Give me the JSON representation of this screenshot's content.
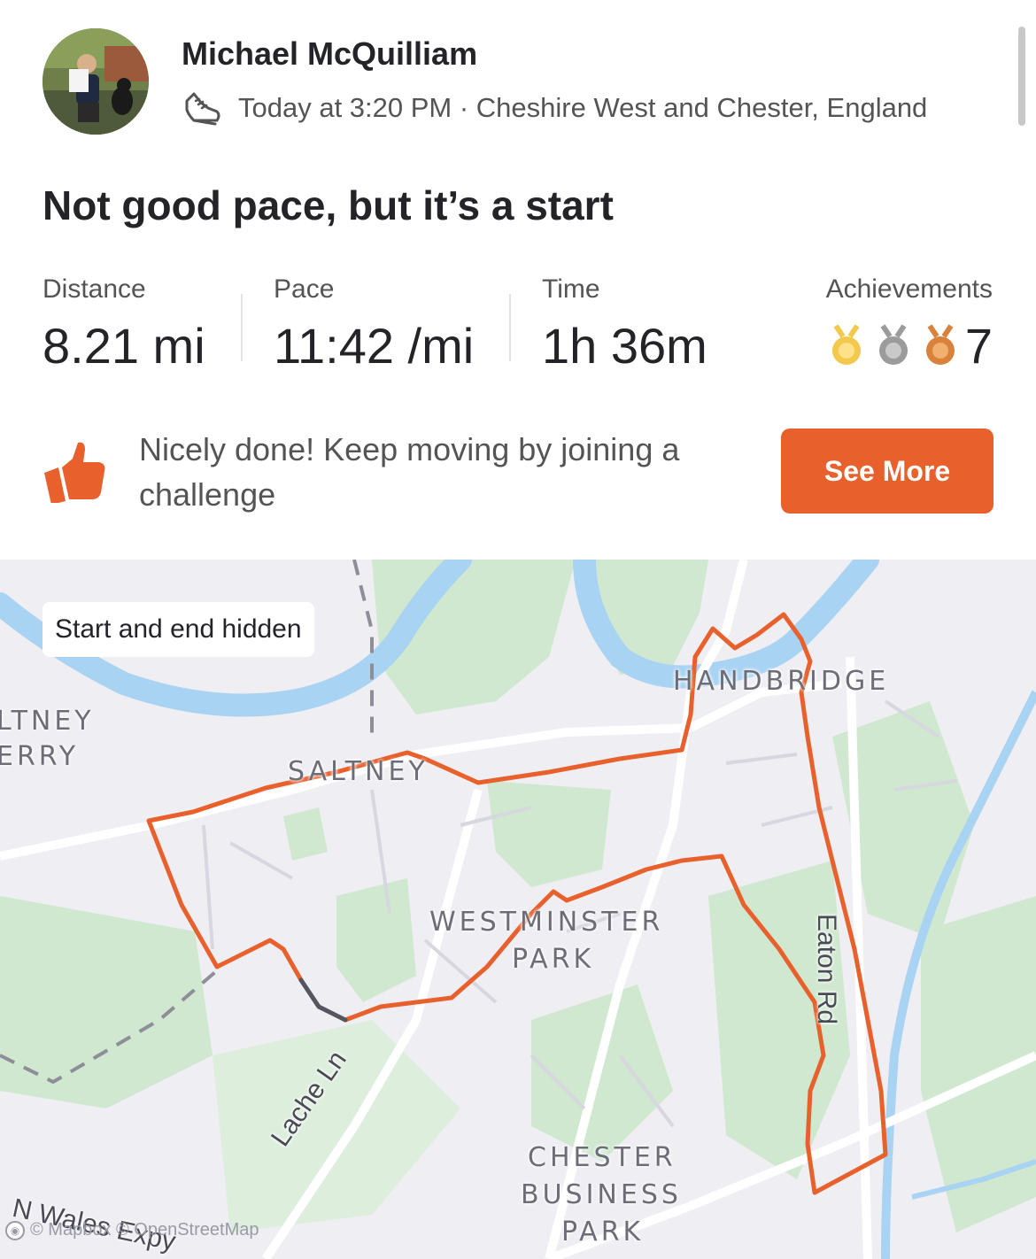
{
  "header": {
    "athlete_name": "Michael McQuilliam",
    "activity_icon": "run-shoe-icon",
    "meta": "Today at 3:20 PM · Cheshire West and Chester, England"
  },
  "activity": {
    "title": "Not good pace, but it’s a start"
  },
  "stats": {
    "distance_label": "Distance",
    "distance_value": "8.21 mi",
    "pace_label": "Pace",
    "pace_value": "11:42 /mi",
    "time_label": "Time",
    "time_value": "1h 36m",
    "achievements_label": "Achievements",
    "achievements_count": "7",
    "medal_icons": [
      "gold-medal-icon",
      "silver-medal-icon",
      "bronze-medal-icon"
    ]
  },
  "promo": {
    "icon": "thumbs-up-icon",
    "text": "Nicely done! Keep moving by joining a challenge",
    "button_label": "See More"
  },
  "map": {
    "privacy_badge": "Start and end hidden",
    "labels": {
      "saltney_ferry_1": "LTNEY",
      "saltney_ferry_2": "ERRY",
      "saltney": "SALTNEY",
      "handbridge": "HANDBRIDGE",
      "westminster": "WESTMINSTER",
      "park": "PARK",
      "chester": "CHESTER",
      "business": "BUSINESS",
      "park2": "PARK",
      "lache_ln": "Lache Ln",
      "n_wales": "N Wales Expy",
      "eaton_rd": "Eaton Rd"
    },
    "attribution": "© Mapbox © OpenStreetMap",
    "route_color": "#e8602c",
    "water_color": "#a9d3f2",
    "green_color": "#cfe8cf"
  },
  "colors": {
    "accent": "#e8602c",
    "gold": "#f2c94c",
    "silver": "#9b9b9b",
    "bronze": "#d9823b"
  }
}
